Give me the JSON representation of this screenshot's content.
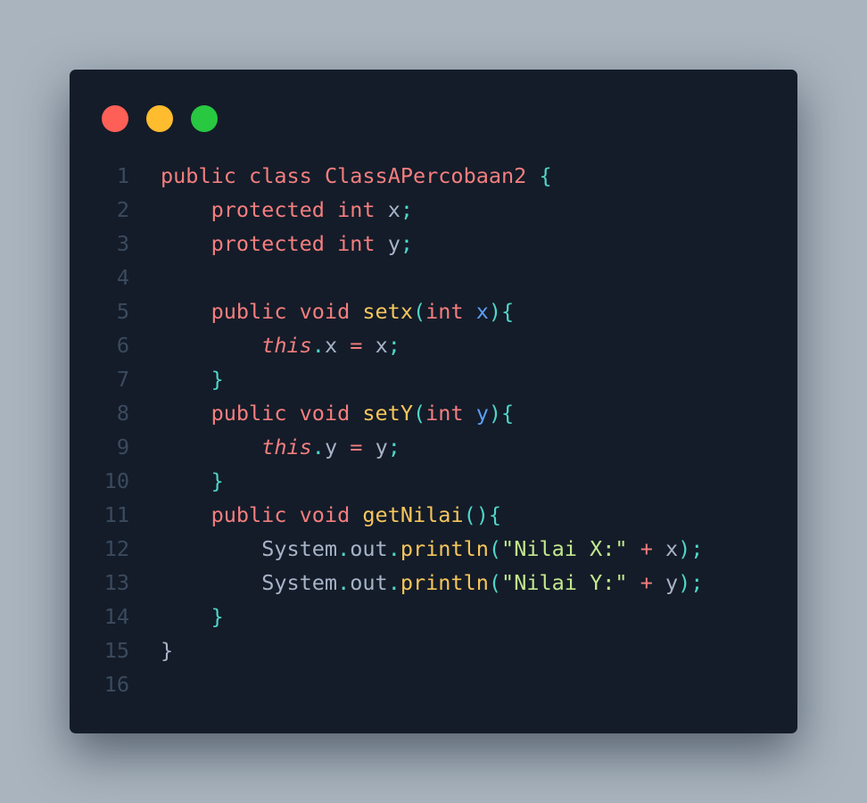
{
  "window": {
    "traffic_lights": [
      {
        "name": "close",
        "color": "#fe5f57"
      },
      {
        "name": "minimize",
        "color": "#febc2e"
      },
      {
        "name": "maximize",
        "color": "#28c840"
      }
    ]
  },
  "colors": {
    "background": "#a9b4be",
    "editor": "#141c29",
    "line_number": "#3b4a5e",
    "keyword": "#f47e7e",
    "plain": "#a7b3c7",
    "punctuation": "#4fd6c8",
    "function": "#f7c65b",
    "parameter": "#5c9ef7",
    "string": "#c3e88d"
  },
  "code": {
    "language": "java",
    "lines": [
      {
        "number": "1",
        "tokens": [
          {
            "t": "public",
            "c": "kw"
          },
          {
            "t": " ",
            "c": "pl"
          },
          {
            "t": "class",
            "c": "kw"
          },
          {
            "t": " ",
            "c": "pl"
          },
          {
            "t": "ClassAPercobaan2",
            "c": "cls"
          },
          {
            "t": " ",
            "c": "pl"
          },
          {
            "t": "{",
            "c": "pu"
          }
        ]
      },
      {
        "number": "2",
        "tokens": [
          {
            "t": "    ",
            "c": "pl"
          },
          {
            "t": "protected",
            "c": "kw"
          },
          {
            "t": " ",
            "c": "pl"
          },
          {
            "t": "int",
            "c": "ty"
          },
          {
            "t": " ",
            "c": "pl"
          },
          {
            "t": "x",
            "c": "pl"
          },
          {
            "t": ";",
            "c": "pu"
          }
        ]
      },
      {
        "number": "3",
        "tokens": [
          {
            "t": "    ",
            "c": "pl"
          },
          {
            "t": "protected",
            "c": "kw"
          },
          {
            "t": " ",
            "c": "pl"
          },
          {
            "t": "int",
            "c": "ty"
          },
          {
            "t": " ",
            "c": "pl"
          },
          {
            "t": "y",
            "c": "pl"
          },
          {
            "t": ";",
            "c": "pu"
          }
        ]
      },
      {
        "number": "4",
        "tokens": []
      },
      {
        "number": "5",
        "tokens": [
          {
            "t": "    ",
            "c": "pl"
          },
          {
            "t": "public",
            "c": "kw"
          },
          {
            "t": " ",
            "c": "pl"
          },
          {
            "t": "void",
            "c": "kw"
          },
          {
            "t": " ",
            "c": "pl"
          },
          {
            "t": "setx",
            "c": "fn"
          },
          {
            "t": "(",
            "c": "pu"
          },
          {
            "t": "int",
            "c": "ty"
          },
          {
            "t": " ",
            "c": "pl"
          },
          {
            "t": "x",
            "c": "pa"
          },
          {
            "t": "){",
            "c": "pu"
          }
        ]
      },
      {
        "number": "6",
        "tokens": [
          {
            "t": "        ",
            "c": "pl"
          },
          {
            "t": "this",
            "c": "th"
          },
          {
            "t": ".",
            "c": "pu"
          },
          {
            "t": "x",
            "c": "pl"
          },
          {
            "t": " ",
            "c": "pl"
          },
          {
            "t": "=",
            "c": "op"
          },
          {
            "t": " ",
            "c": "pl"
          },
          {
            "t": "x",
            "c": "pl"
          },
          {
            "t": ";",
            "c": "pu"
          }
        ]
      },
      {
        "number": "7",
        "tokens": [
          {
            "t": "    ",
            "c": "pl"
          },
          {
            "t": "}",
            "c": "pu"
          }
        ]
      },
      {
        "number": "8",
        "tokens": [
          {
            "t": "    ",
            "c": "pl"
          },
          {
            "t": "public",
            "c": "kw"
          },
          {
            "t": " ",
            "c": "pl"
          },
          {
            "t": "void",
            "c": "kw"
          },
          {
            "t": " ",
            "c": "pl"
          },
          {
            "t": "setY",
            "c": "fn"
          },
          {
            "t": "(",
            "c": "pu"
          },
          {
            "t": "int",
            "c": "ty"
          },
          {
            "t": " ",
            "c": "pl"
          },
          {
            "t": "y",
            "c": "pa"
          },
          {
            "t": "){",
            "c": "pu"
          }
        ]
      },
      {
        "number": "9",
        "tokens": [
          {
            "t": "        ",
            "c": "pl"
          },
          {
            "t": "this",
            "c": "th"
          },
          {
            "t": ".",
            "c": "pu"
          },
          {
            "t": "y",
            "c": "pl"
          },
          {
            "t": " ",
            "c": "pl"
          },
          {
            "t": "=",
            "c": "op"
          },
          {
            "t": " ",
            "c": "pl"
          },
          {
            "t": "y",
            "c": "pl"
          },
          {
            "t": ";",
            "c": "pu"
          }
        ]
      },
      {
        "number": "10",
        "tokens": [
          {
            "t": "    ",
            "c": "pl"
          },
          {
            "t": "}",
            "c": "pu"
          }
        ]
      },
      {
        "number": "11",
        "tokens": [
          {
            "t": "    ",
            "c": "pl"
          },
          {
            "t": "public",
            "c": "kw"
          },
          {
            "t": " ",
            "c": "pl"
          },
          {
            "t": "void",
            "c": "kw"
          },
          {
            "t": " ",
            "c": "pl"
          },
          {
            "t": "getNilai",
            "c": "fn"
          },
          {
            "t": "(){",
            "c": "pu"
          }
        ]
      },
      {
        "number": "12",
        "tokens": [
          {
            "t": "        ",
            "c": "pl"
          },
          {
            "t": "System",
            "c": "pl"
          },
          {
            "t": ".",
            "c": "pu"
          },
          {
            "t": "out",
            "c": "pl"
          },
          {
            "t": ".",
            "c": "pu"
          },
          {
            "t": "println",
            "c": "fn"
          },
          {
            "t": "(",
            "c": "pu"
          },
          {
            "t": "\"Nilai X:\"",
            "c": "st"
          },
          {
            "t": " ",
            "c": "pl"
          },
          {
            "t": "+",
            "c": "op"
          },
          {
            "t": " ",
            "c": "pl"
          },
          {
            "t": "x",
            "c": "pl"
          },
          {
            "t": ");",
            "c": "pu"
          }
        ]
      },
      {
        "number": "13",
        "tokens": [
          {
            "t": "        ",
            "c": "pl"
          },
          {
            "t": "System",
            "c": "pl"
          },
          {
            "t": ".",
            "c": "pu"
          },
          {
            "t": "out",
            "c": "pl"
          },
          {
            "t": ".",
            "c": "pu"
          },
          {
            "t": "println",
            "c": "fn"
          },
          {
            "t": "(",
            "c": "pu"
          },
          {
            "t": "\"Nilai Y:\"",
            "c": "st"
          },
          {
            "t": " ",
            "c": "pl"
          },
          {
            "t": "+",
            "c": "op"
          },
          {
            "t": " ",
            "c": "pl"
          },
          {
            "t": "y",
            "c": "pl"
          },
          {
            "t": ");",
            "c": "pu"
          }
        ]
      },
      {
        "number": "14",
        "tokens": [
          {
            "t": "    ",
            "c": "pl"
          },
          {
            "t": "}",
            "c": "pu"
          }
        ]
      },
      {
        "number": "15",
        "tokens": [
          {
            "t": "}",
            "c": "pl"
          }
        ]
      },
      {
        "number": "16",
        "tokens": []
      }
    ]
  }
}
